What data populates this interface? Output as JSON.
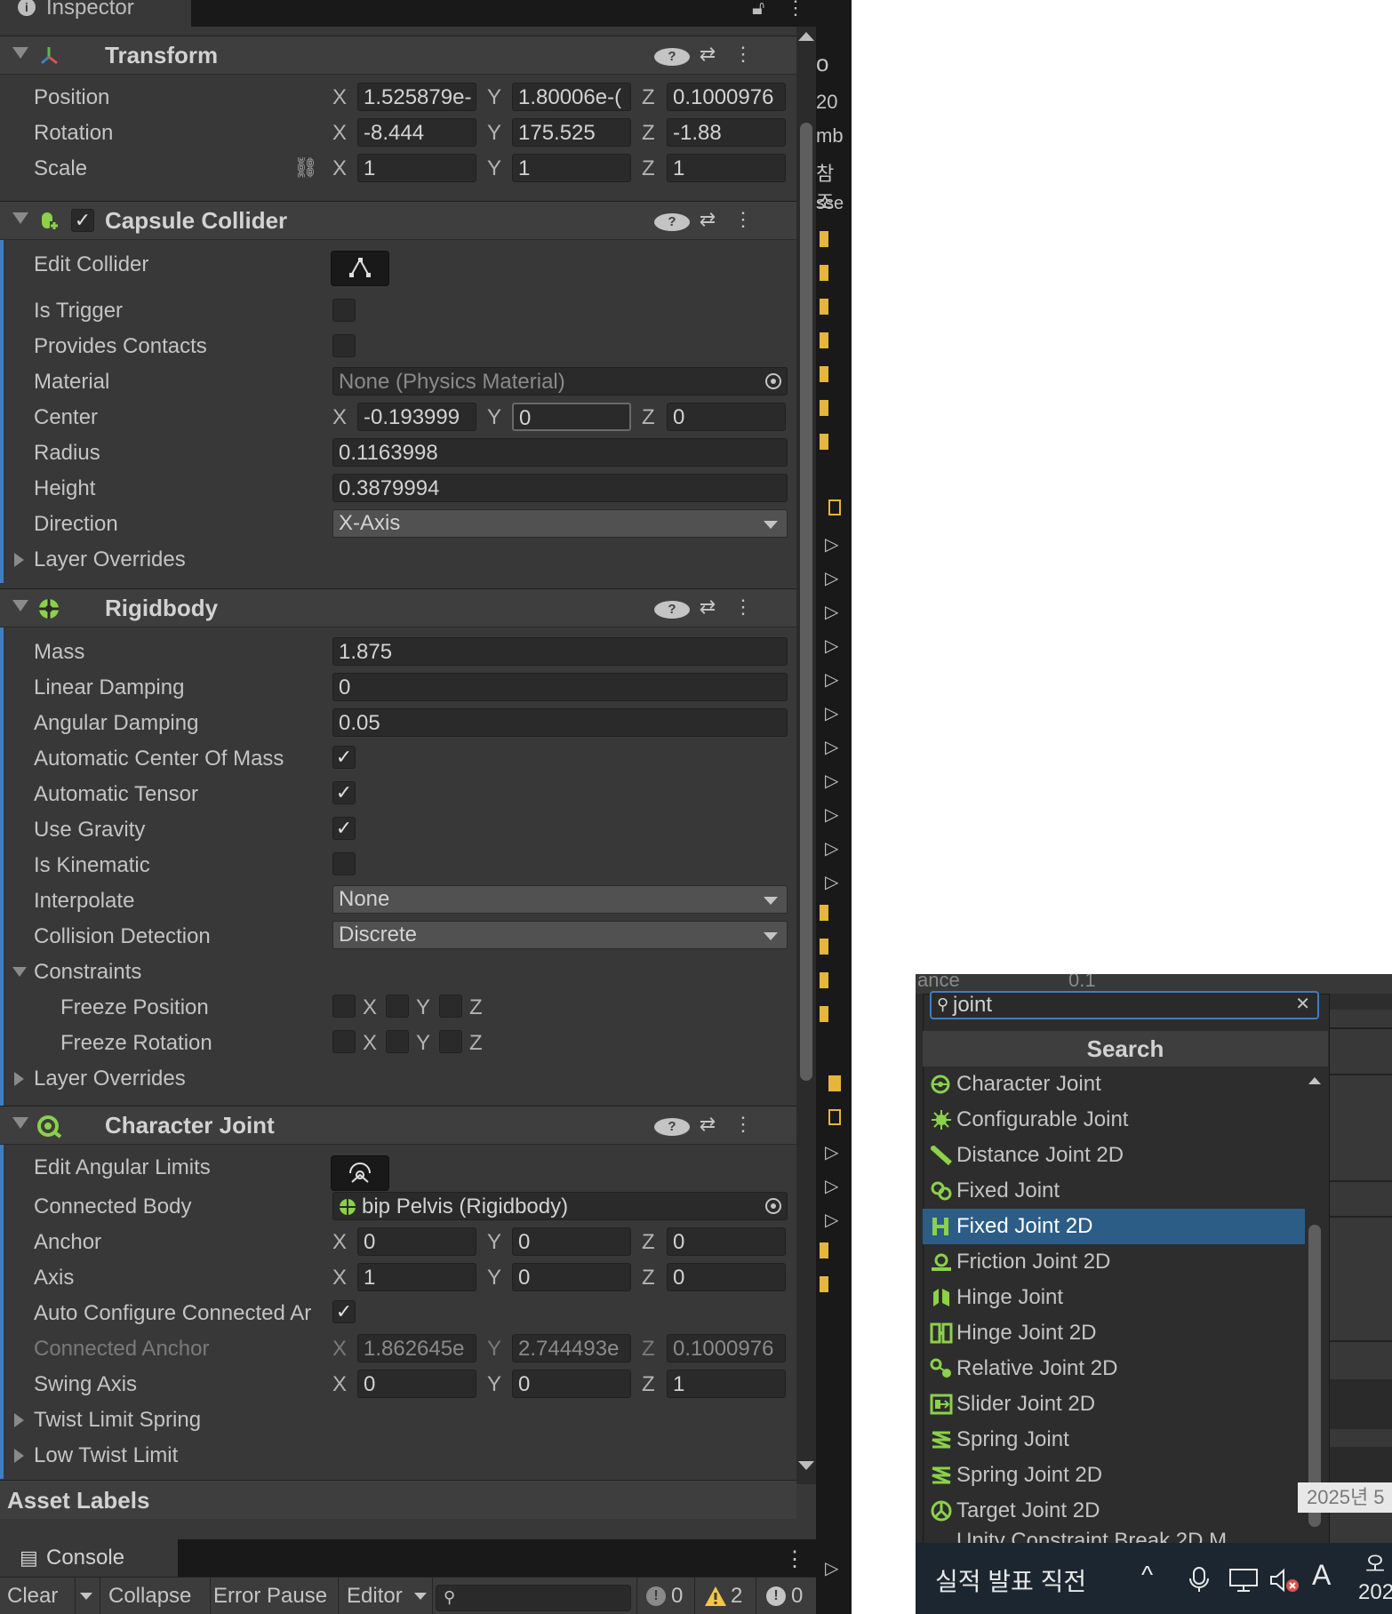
{
  "inspector": {
    "tab_label": "Inspector",
    "transform": {
      "title": "Transform",
      "position": {
        "label": "Position",
        "x": "1.525879e-",
        "y": "1.80006e-(",
        "z": "0.1000976"
      },
      "rotation": {
        "label": "Rotation",
        "x": "-8.444",
        "y": "175.525",
        "z": "-1.88"
      },
      "scale": {
        "label": "Scale",
        "x": "1",
        "y": "1",
        "z": "1"
      }
    },
    "axis_labels": {
      "x": "X",
      "y": "Y",
      "z": "Z"
    },
    "capsule": {
      "title": "Capsule Collider",
      "edit_collider": "Edit Collider",
      "is_trigger": "Is Trigger",
      "provides_contacts": "Provides Contacts",
      "material_label": "Material",
      "material_value": "None (Physics Material)",
      "center_label": "Center",
      "center": {
        "x": "-0.193999",
        "y": "0",
        "z": "0"
      },
      "radius_label": "Radius",
      "radius": "0.1163998",
      "height_label": "Height",
      "height": "0.3879994",
      "direction_label": "Direction",
      "direction": "X-Axis",
      "layer_overrides": "Layer Overrides"
    },
    "rigidbody": {
      "title": "Rigidbody",
      "mass_label": "Mass",
      "mass": "1.875",
      "linear_damping_label": "Linear Damping",
      "linear_damping": "0",
      "angular_damping_label": "Angular Damping",
      "angular_damping": "0.05",
      "auto_com": "Automatic Center Of Mass",
      "auto_tensor": "Automatic Tensor",
      "use_gravity": "Use Gravity",
      "is_kinematic": "Is Kinematic",
      "interpolate_label": "Interpolate",
      "interpolate": "None",
      "collision_label": "Collision Detection",
      "collision": "Discrete",
      "constraints": "Constraints",
      "freeze_position": "Freeze Position",
      "freeze_rotation": "Freeze Rotation",
      "layer_overrides": "Layer Overrides"
    },
    "joint": {
      "title": "Character Joint",
      "edit_angular": "Edit Angular Limits",
      "connected_body_label": "Connected Body",
      "connected_body": "bip Pelvis (Rigidbody)",
      "anchor_label": "Anchor",
      "anchor": {
        "x": "0",
        "y": "0",
        "z": "0"
      },
      "axis_label": "Axis",
      "axis": {
        "x": "1",
        "y": "0",
        "z": "0"
      },
      "auto_configure": "Auto Configure Connected Ar",
      "connected_anchor_label": "Connected Anchor",
      "connected_anchor": {
        "x": "1.862645e",
        "y": "2.744493e",
        "z": "0.1000976"
      },
      "swing_axis_label": "Swing Axis",
      "swing_axis": {
        "x": "0",
        "y": "0",
        "z": "1"
      },
      "twist_spring": "Twist Limit Spring",
      "low_twist": "Low Twist Limit"
    },
    "asset_labels": "Asset Labels"
  },
  "console": {
    "tab_label": "Console",
    "clear": "Clear",
    "collapse": "Collapse",
    "error_pause": "Error Pause",
    "editor": "Editor",
    "info_count": "0",
    "warn_count": "2",
    "error_count": "0"
  },
  "side_panel_chars": [
    "o",
    "20",
    "mb",
    "참조",
    "sse"
  ],
  "popup": {
    "behind_text": "ance",
    "behind_value": "0.1",
    "search_value": "joint",
    "title": "Search",
    "items": [
      "Character Joint",
      "Configurable Joint",
      "Distance Joint 2D",
      "Fixed Joint",
      "Fixed Joint 2D",
      "Friction Joint 2D",
      "Hinge Joint",
      "Hinge Joint 2D",
      "Relative Joint 2D",
      "Slider Joint 2D",
      "Spring Joint",
      "Spring Joint 2D",
      "Target Joint 2D"
    ],
    "partial_item": "Unity Constraint Break 2D M",
    "selected_index": 4
  },
  "taskbar": {
    "notification": "실적 발표 직전",
    "ime": "A",
    "time_fragment": "오",
    "date_fragment": "202",
    "tooltip": "2025년 5"
  },
  "colors": {
    "accent": "#3d7fc5",
    "selection": "#2c5d87",
    "icon_green": "#8bd14a",
    "warning": "#f2c744"
  }
}
